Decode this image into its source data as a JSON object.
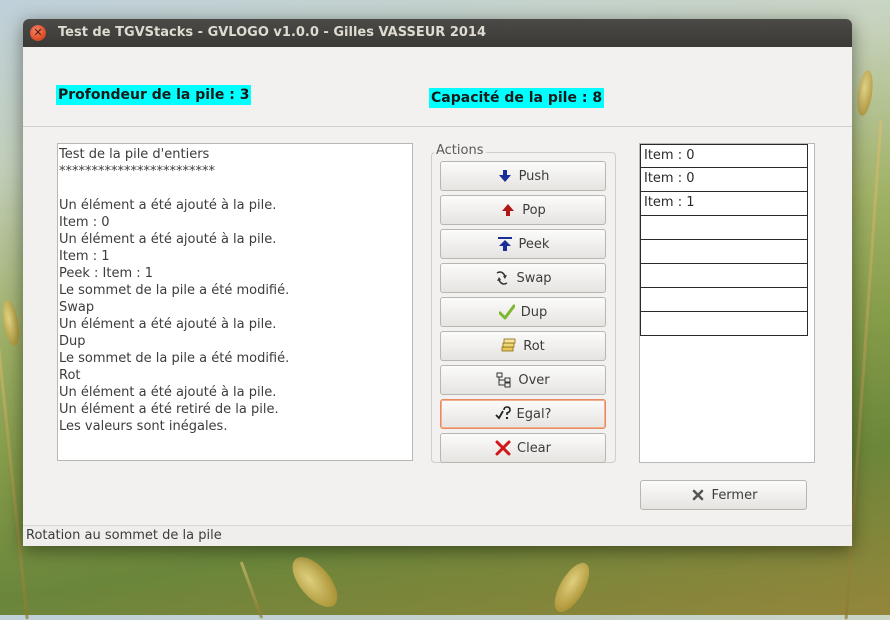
{
  "window": {
    "title": "Test de TGVStacks - GVLOGO v1.0.0 - Gilles VASSEUR 2014",
    "close_symbol": "✕"
  },
  "stats": {
    "depth_label": "Profondeur de la pile : 3",
    "capacity_label": "Capacité de la pile : 8"
  },
  "log": {
    "lines": [
      "Test de la pile d'entiers",
      "************************",
      "",
      "Un élément a été ajouté à la pile.",
      "Item : 0",
      "Un élément a été ajouté à la pile.",
      "Item : 1",
      "Peek : Item : 1",
      "Le sommet de la pile a été modifié.",
      "Swap",
      "Un élément a été ajouté à la pile.",
      "Dup",
      "Le sommet de la pile a été modifié.",
      "Rot",
      "Un élément a été ajouté à la pile.",
      "Un élément a été retiré de la pile.",
      "Les valeurs sont inégales."
    ]
  },
  "actions": {
    "title": "Actions",
    "push": "Push",
    "pop": "Pop",
    "peek": "Peek",
    "swap": "Swap",
    "dup": "Dup",
    "rot": "Rot",
    "over": "Over",
    "egal": "Egal?",
    "clear": "Clear"
  },
  "stack": {
    "cells": [
      "Item : 0",
      "Item : 0",
      "Item : 1",
      "",
      "",
      "",
      "",
      ""
    ]
  },
  "footer": {
    "close_label": "Fermer",
    "status": "Rotation au sommet de la pile"
  },
  "colors": {
    "highlight": "#00ffff",
    "focus_border": "#e9895e"
  }
}
